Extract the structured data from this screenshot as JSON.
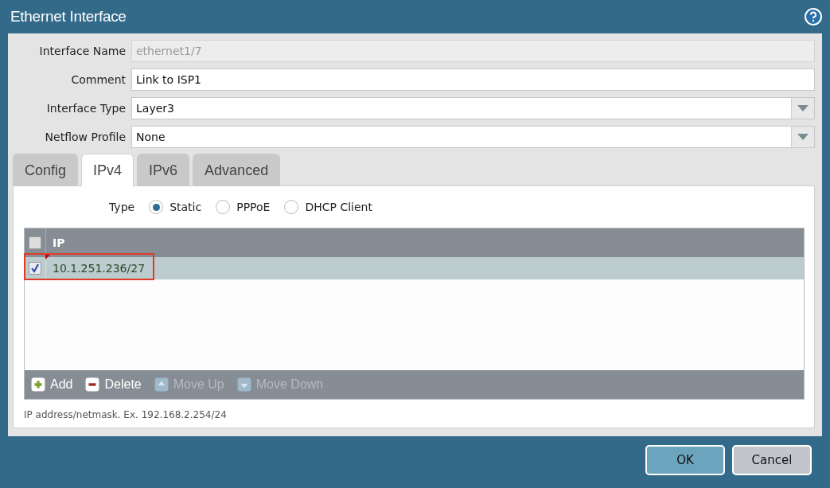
{
  "window": {
    "title": "Ethernet Interface"
  },
  "fields": [
    {
      "label": "Interface Name",
      "value": "ethernet1/7",
      "kind": "text",
      "disabled": true
    },
    {
      "label": "Comment",
      "value": "Link to ISP1",
      "kind": "text",
      "disabled": false
    },
    {
      "label": "Interface Type",
      "value": "Layer3",
      "kind": "select"
    },
    {
      "label": "Netflow Profile",
      "value": "None",
      "kind": "select"
    }
  ],
  "tabs": [
    {
      "label": "Config",
      "selected": false
    },
    {
      "label": "IPv4",
      "selected": true
    },
    {
      "label": "IPv6",
      "selected": false
    },
    {
      "label": "Advanced",
      "selected": false
    }
  ],
  "address_type": {
    "label": "Type",
    "options": [
      {
        "label": "Static",
        "selected": true
      },
      {
        "label": "PPPoE",
        "selected": false
      },
      {
        "label": "DHCP Client",
        "selected": false
      }
    ]
  },
  "table": {
    "columns": [
      "IP"
    ],
    "header_checked": false,
    "rows": [
      {
        "ip": "10.1.251.236/27",
        "checked": true,
        "selected": true,
        "highlighted": true
      }
    ]
  },
  "toolbar": [
    {
      "label": "Add",
      "kind": "add",
      "disabled": false
    },
    {
      "label": "Delete",
      "kind": "delete",
      "disabled": false
    },
    {
      "label": "Move Up",
      "kind": "up",
      "disabled": true
    },
    {
      "label": "Move Down",
      "kind": "down",
      "disabled": true
    }
  ],
  "hint": "IP address/netmask. Ex. 192.168.2.254/24",
  "buttons": [
    {
      "label": "OK",
      "kind": "primary"
    },
    {
      "label": "Cancel",
      "kind": "secondary"
    }
  ]
}
